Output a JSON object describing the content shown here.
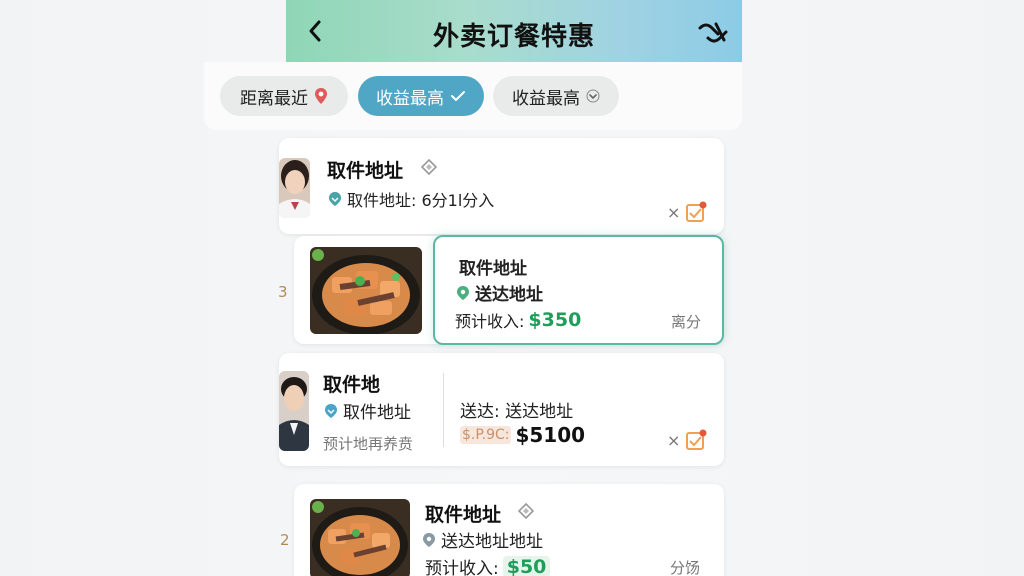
{
  "header": {
    "title": "外卖订餐特惠"
  },
  "filters": [
    {
      "label": "距离最近"
    },
    {
      "label": "收益最高"
    },
    {
      "label": "收益最高"
    }
  ],
  "orders": {
    "o1": {
      "name": "取件地址",
      "detail": "取件地址: 6分1l分入"
    },
    "o2": {
      "pickup": "取件地址",
      "dropoff": "送达地址",
      "income_label": "预计收入:",
      "income": "$350",
      "tag": "离分",
      "side": "3"
    },
    "o3": {
      "name": "取件地",
      "detail": "取件地址",
      "note": "预计地再养贲",
      "dropoff": "送达: 送达地址",
      "price_prefix": "$.P.9C:",
      "price": "$5100"
    },
    "o4": {
      "pickup": "取件地址",
      "dropoff": "送达地址地址",
      "income_label": "预计收入:",
      "income": "$50",
      "tag": "分饧",
      "side": "2"
    }
  },
  "colors": {
    "accent": "#4fa7c5",
    "money": "#1f9e5a",
    "pin": "#e05a5a",
    "teal": "#5cb7a4",
    "check": "#f0a050"
  },
  "icons": {
    "back": "chevron-left-icon",
    "header_action": "link-icon",
    "pin": "map-pin-icon",
    "check": "check-square-icon",
    "close": "close-icon",
    "diamond": "diamond-icon"
  }
}
